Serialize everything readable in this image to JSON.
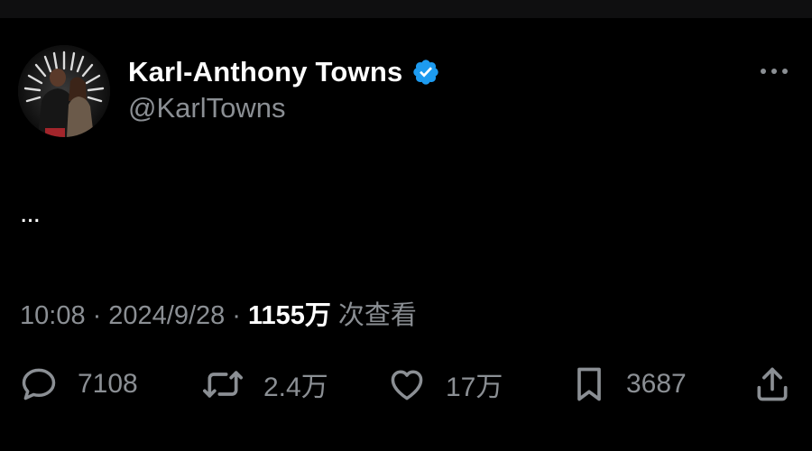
{
  "tweet": {
    "author": {
      "display_name": "Karl-Anthony Towns",
      "handle": "@KarlTowns",
      "verified": true,
      "verified_color": "#1d9bf0"
    },
    "text": "...",
    "time": "10:08",
    "date": "2024/9/28",
    "separator": "·",
    "views_count": "1155万",
    "views_label": "次查看"
  },
  "actions": {
    "reply_count": "7108",
    "retweet_count": "2.4万",
    "like_count": "17万",
    "bookmark_count": "3687"
  },
  "icons": {
    "more": "more-horizontal-icon",
    "reply": "reply-bubble-icon",
    "retweet": "retweet-icon",
    "like": "heart-icon",
    "bookmark": "bookmark-icon",
    "share": "share-upload-icon"
  },
  "colors": {
    "background": "#000000",
    "primary_text": "#ffffff",
    "secondary_text": "#8b8f94"
  }
}
